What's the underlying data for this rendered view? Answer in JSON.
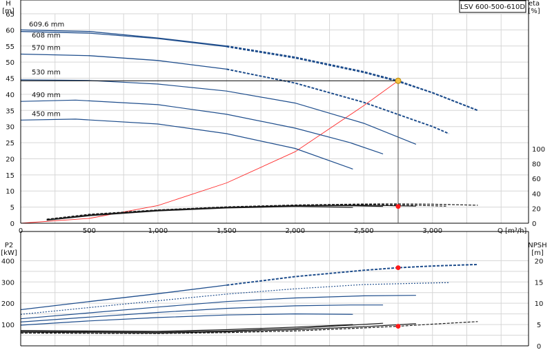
{
  "model_label": "LSV 600-500-610D",
  "colors": {
    "blue": "#1e4d8c",
    "black": "#1a1a1a",
    "system_curve": "#ff2b2b",
    "duty_marker": "#ff1a1a",
    "duty_point_fill": "#f5c242",
    "grid": "#d6d6d6",
    "op_line": "#555555"
  },
  "chart_data": [
    {
      "id": "head_chart",
      "type": "line",
      "xlabel": "Q [m³/h]",
      "ylabel_left": "H\n[m]",
      "ylabel_right": "eta\n[%]",
      "xlim": [
        0,
        3700
      ],
      "ylim_left": [
        0,
        65
      ],
      "ylim_right": [
        0,
        100
      ],
      "x_ticks": [
        0,
        500,
        1000,
        1500,
        2000,
        2500,
        3000
      ],
      "x_tick_labels": [
        "0",
        "500",
        "1,000",
        "1,500",
        "2,000",
        "2,500",
        "3,000"
      ],
      "y_ticks_left": [
        0,
        5,
        10,
        15,
        20,
        25,
        30,
        35,
        40,
        45,
        50,
        55,
        60,
        65
      ],
      "y_ticks_right": [
        0,
        20,
        40,
        60,
        80,
        100
      ],
      "grid": true,
      "head_curves": [
        {
          "name": "609.6 mm",
          "style": "solid-dashed",
          "points": [
            [
              0,
              60
            ],
            [
              500,
              59.5
            ],
            [
              1000,
              57.5
            ],
            [
              1500,
              55
            ],
            [
              2000,
              51.5
            ],
            [
              2500,
              47
            ],
            [
              2750,
              44.2
            ],
            [
              3000,
              40.5
            ],
            [
              3330,
              35
            ]
          ]
        },
        {
          "name": "608 mm",
          "style": "solid-dashed",
          "points": [
            [
              0,
              59.5
            ],
            [
              500,
              59
            ],
            [
              1000,
              57.3
            ],
            [
              1500,
              54.8
            ],
            [
              2000,
              51.3
            ],
            [
              2500,
              46.8
            ],
            [
              2750,
              44
            ],
            [
              3000,
              40.5
            ],
            [
              3330,
              35
            ]
          ]
        },
        {
          "name": "570 mm",
          "style": "solid-dashed",
          "points": [
            [
              0,
              52.5
            ],
            [
              500,
              52
            ],
            [
              1000,
              50.5
            ],
            [
              1500,
              47.8
            ],
            [
              2000,
              43.5
            ],
            [
              2500,
              37.5
            ],
            [
              2800,
              33
            ],
            [
              3000,
              30
            ],
            [
              3120,
              27.8
            ]
          ]
        },
        {
          "name": "530 mm",
          "style": "solid",
          "points": [
            [
              0,
              44.5
            ],
            [
              500,
              44.3
            ],
            [
              1000,
              43.2
            ],
            [
              1500,
              41
            ],
            [
              2000,
              37.3
            ],
            [
              2500,
              31
            ],
            [
              2880,
              24.5
            ]
          ]
        },
        {
          "name": "490 mm",
          "style": "solid",
          "points": [
            [
              0,
              37.8
            ],
            [
              400,
              38.2
            ],
            [
              1000,
              36.8
            ],
            [
              1500,
              33.8
            ],
            [
              2000,
              29.5
            ],
            [
              2400,
              25
            ],
            [
              2640,
              21.5
            ]
          ]
        },
        {
          "name": "450 mm",
          "style": "solid",
          "points": [
            [
              0,
              32
            ],
            [
              400,
              32.3
            ],
            [
              1000,
              30.8
            ],
            [
              1500,
              27.8
            ],
            [
              2000,
              23.2
            ],
            [
              2420,
              16.8
            ]
          ]
        }
      ],
      "efficiency_curves": [
        {
          "name": "609.6 mm",
          "style": "dashed",
          "points": [
            [
              190,
              5.5
            ],
            [
              500,
              12
            ],
            [
              1000,
              18
            ],
            [
              1500,
              22
            ],
            [
              2000,
              24.5
            ],
            [
              2500,
              25.8
            ],
            [
              2750,
              26
            ],
            [
              3000,
              25.6
            ],
            [
              3330,
              24.2
            ]
          ]
        },
        {
          "name": "570 mm",
          "style": "dashed",
          "points": [
            [
              190,
              5
            ],
            [
              500,
              11.5
            ],
            [
              1000,
              17.7
            ],
            [
              1500,
              21.8
            ],
            [
              2000,
              24.2
            ],
            [
              2500,
              25
            ],
            [
              2800,
              24.5
            ],
            [
              3100,
              23
            ]
          ]
        },
        {
          "name": "530 mm",
          "style": "solid",
          "points": [
            [
              190,
              4.6
            ],
            [
              500,
              11
            ],
            [
              1000,
              17.5
            ],
            [
              1500,
              21.5
            ],
            [
              2000,
              23.8
            ],
            [
              2500,
              24.3
            ],
            [
              2880,
              23
            ]
          ]
        },
        {
          "name": "490 mm",
          "style": "solid",
          "points": [
            [
              190,
              4.3
            ],
            [
              500,
              10.5
            ],
            [
              1000,
              17
            ],
            [
              1500,
              21
            ],
            [
              2000,
              23.3
            ],
            [
              2400,
              23.5
            ],
            [
              2640,
              22.5
            ]
          ]
        },
        {
          "name": "450 mm",
          "style": "solid",
          "points": [
            [
              190,
              4
            ],
            [
              500,
              10
            ],
            [
              1000,
              16.5
            ],
            [
              1500,
              20.5
            ],
            [
              2000,
              22.5
            ],
            [
              2420,
              21.3
            ]
          ]
        }
      ],
      "system_curve": {
        "points": [
          [
            0,
            0
          ],
          [
            500,
            1.5
          ],
          [
            1000,
            5.5
          ],
          [
            1500,
            12.5
          ],
          [
            2000,
            22.2
          ],
          [
            2500,
            36.5
          ],
          [
            2750,
            44.2
          ]
        ]
      },
      "duty_point": {
        "x": 2750,
        "y": 44.2
      },
      "efficiency_point": {
        "x": 2750,
        "y": 22.5
      }
    },
    {
      "id": "power_chart",
      "type": "line",
      "xlabel": "",
      "ylabel_left": "P2\n[kW]",
      "ylabel_right": "NPSH\n[m]",
      "xlim": [
        0,
        3700
      ],
      "ylim_left": [
        0,
        440
      ],
      "ylim_right": [
        0,
        22
      ],
      "y_ticks_left": [
        100,
        200,
        300,
        400
      ],
      "y_ticks_right": [
        0,
        5,
        10,
        15,
        20
      ],
      "grid": true,
      "power_curves": [
        {
          "name": "609.6 mm",
          "style": "solid-dashed",
          "points": [
            [
              0,
              170
            ],
            [
              500,
              208
            ],
            [
              1000,
              245
            ],
            [
              1500,
              285
            ],
            [
              2000,
              325
            ],
            [
              2500,
              355
            ],
            [
              2750,
              367
            ],
            [
              3000,
              375
            ],
            [
              3330,
              382
            ]
          ]
        },
        {
          "name": "570 mm",
          "style": "dotted",
          "points": [
            [
              0,
              148
            ],
            [
              500,
              180
            ],
            [
              1000,
              212
            ],
            [
              1500,
              243
            ],
            [
              2000,
              268
            ],
            [
              2500,
              288
            ],
            [
              3120,
              297
            ]
          ]
        },
        {
          "name": "530 mm",
          "style": "solid",
          "points": [
            [
              0,
              127
            ],
            [
              500,
              155
            ],
            [
              1000,
              182
            ],
            [
              1500,
              208
            ],
            [
              2000,
              225
            ],
            [
              2500,
              235
            ],
            [
              2880,
              237
            ]
          ]
        },
        {
          "name": "490 mm",
          "style": "solid",
          "points": [
            [
              0,
              112
            ],
            [
              500,
              135
            ],
            [
              1000,
              157
            ],
            [
              1500,
              176
            ],
            [
              2000,
              188
            ],
            [
              2400,
              192
            ],
            [
              2640,
              192
            ]
          ]
        },
        {
          "name": "450 mm",
          "style": "solid",
          "points": [
            [
              0,
              97
            ],
            [
              500,
              117
            ],
            [
              1000,
              133
            ],
            [
              1500,
              145
            ],
            [
              2000,
              150
            ],
            [
              2420,
              148
            ]
          ]
        }
      ],
      "npsh_curves": [
        {
          "name": "609.6 mm",
          "style": "dashed",
          "points": [
            [
              0,
              3
            ],
            [
              1000,
              2.9
            ],
            [
              1500,
              3.1
            ],
            [
              2000,
              3.5
            ],
            [
              2500,
              4.2
            ],
            [
              2750,
              4.6
            ],
            [
              3000,
              5.1
            ],
            [
              3330,
              5.7
            ]
          ]
        },
        {
          "name": "570 mm",
          "style": "solid",
          "points": [
            [
              0,
              3.2
            ],
            [
              1000,
              3
            ],
            [
              1500,
              3.3
            ],
            [
              2000,
              3.8
            ],
            [
              2500,
              4.5
            ],
            [
              2880,
              5.2
            ]
          ]
        },
        {
          "name": "530 mm",
          "style": "solid",
          "points": [
            [
              0,
              3.4
            ],
            [
              1000,
              3.2
            ],
            [
              1500,
              3.5
            ],
            [
              2000,
              4.1
            ],
            [
              2640,
              5.3
            ]
          ]
        },
        {
          "name": "450 mm",
          "style": "solid",
          "points": [
            [
              0,
              3.6
            ],
            [
              1000,
              3.4
            ],
            [
              1500,
              3.8
            ],
            [
              2000,
              4.4
            ],
            [
              2420,
              5
            ]
          ]
        }
      ],
      "power_point": {
        "x": 2750,
        "y": 367
      },
      "npsh_point": {
        "x": 2750,
        "y": 4.6
      }
    }
  ]
}
